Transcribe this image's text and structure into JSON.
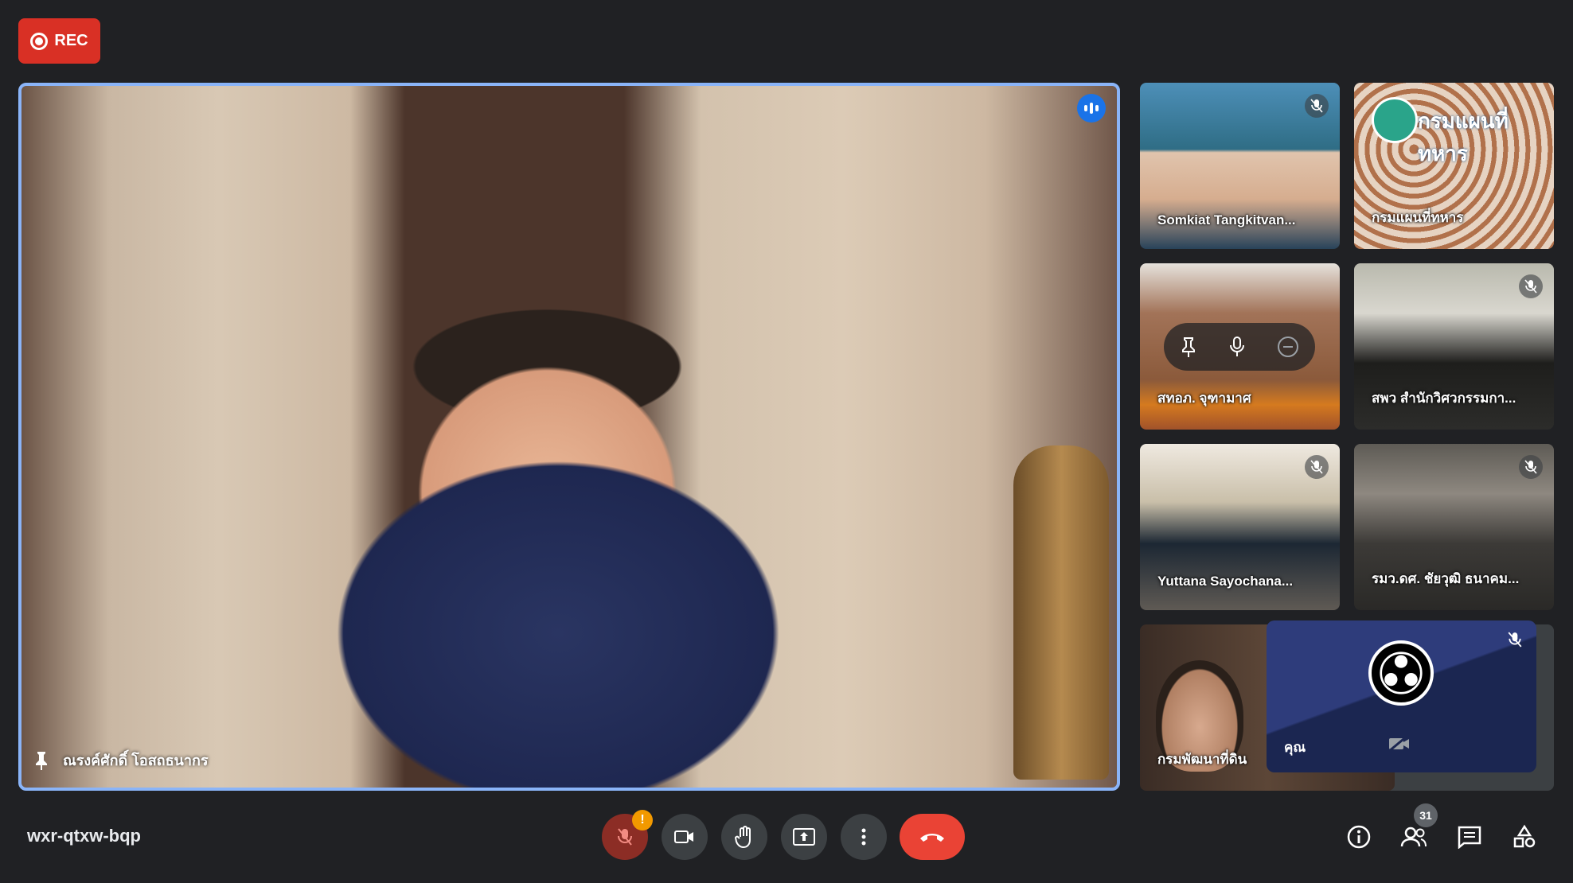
{
  "recording": {
    "label": "REC"
  },
  "main": {
    "speaker_name": "ณรงค์ศักดิ์ โอสถธนากร"
  },
  "tiles": [
    {
      "name": "Somkiat Tangkitvan...",
      "muted": true
    },
    {
      "name": "กรมแผนที่ทหาร",
      "banner": "กรมแผนที่ทหาร",
      "muted": false
    },
    {
      "name": "สทอภ. จุฑามาศ",
      "muted": false
    },
    {
      "name": "สพว สำนักวิศวกรรมกา...",
      "muted": true
    },
    {
      "name": "Yuttana Sayochana...",
      "muted": true
    },
    {
      "name": "รมว.ดศ. ชัยวุฒิ ธนาคม...",
      "muted": true
    },
    {
      "name": "กรมพัฒนาที่ดิน",
      "muted": false
    }
  ],
  "self_tile": {
    "label": "คุณ",
    "muted": true,
    "camera_off": true
  },
  "meeting": {
    "code": "wxr-qtxw-bqp"
  },
  "controls": {
    "mic_warning": "!"
  },
  "participants": {
    "count": "31"
  },
  "colors": {
    "accent": "#8ab4f8",
    "leave": "#ea4335",
    "rec": "#d93025",
    "speaking": "#1a73e8"
  }
}
